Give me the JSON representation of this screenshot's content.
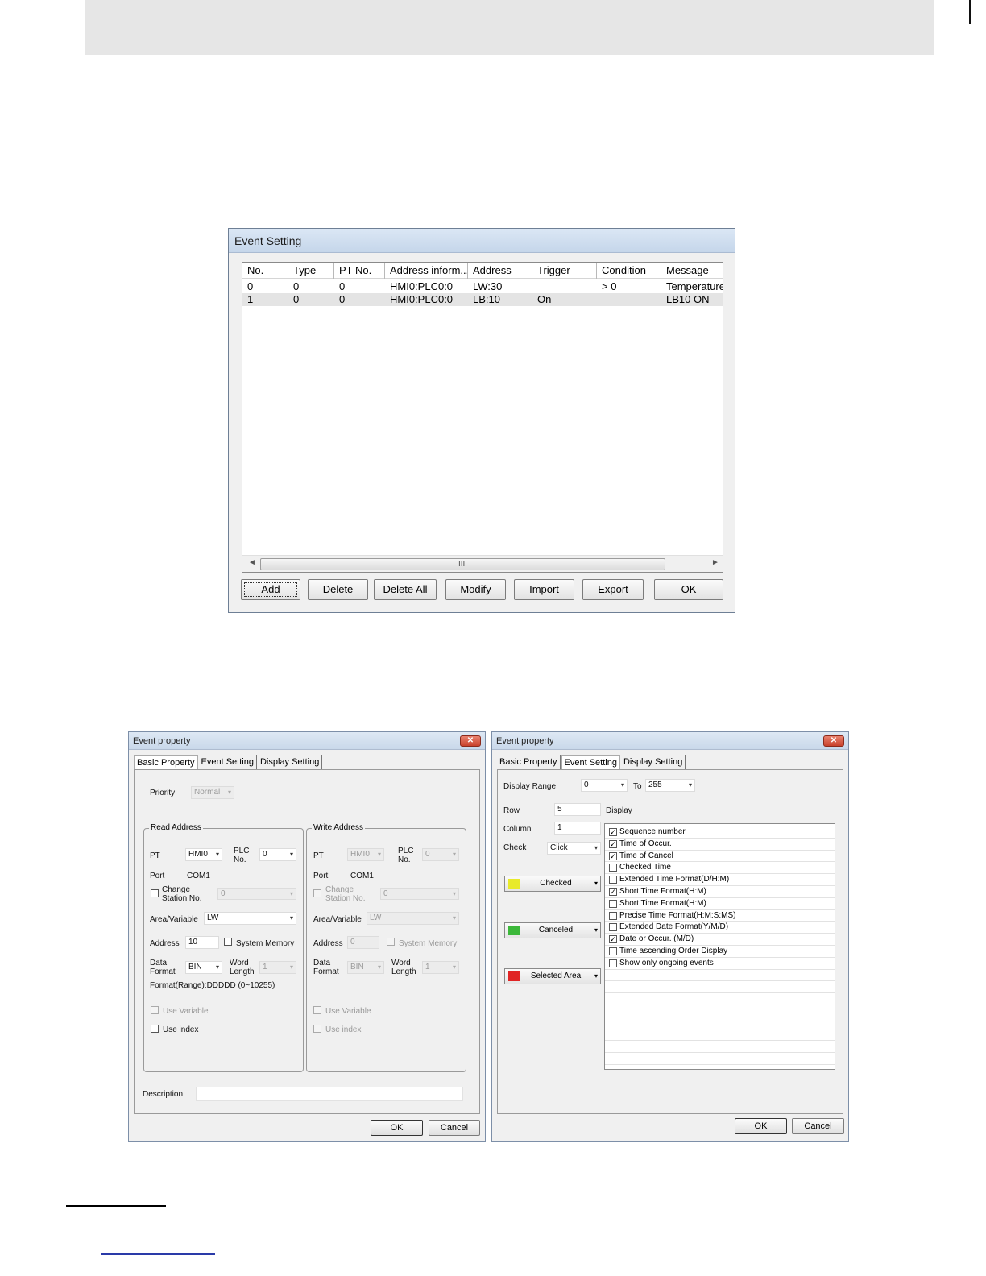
{
  "event_setting": {
    "title": "Event Setting",
    "columns": [
      "No.",
      "Type",
      "PT No.",
      "Address inform...",
      "Address",
      "Trigger",
      "Condition",
      "Message"
    ],
    "rows": [
      [
        "0",
        "0",
        "0",
        "HMI0:PLC0:0",
        "LW:30",
        "",
        "> 0",
        "Temperature"
      ],
      [
        "1",
        "0",
        "0",
        "HMI0:PLC0:0",
        "LB:10",
        "On",
        "",
        "LB10 ON"
      ]
    ],
    "scroll": {
      "left": "◄",
      "right": "►",
      "grip": "III"
    },
    "buttons": {
      "add": "Add",
      "delete": "Delete",
      "delete_all": "Delete All",
      "modify": "Modify",
      "import": "Import",
      "export": "Export",
      "ok": "OK"
    }
  },
  "left_dialog": {
    "title": "Event property",
    "close": "✕",
    "tabs": [
      "Basic Property",
      "Event Setting",
      "Display Setting"
    ],
    "priority_label": "Priority",
    "priority_value": "Normal",
    "read": {
      "group": "Read Address",
      "pt_label": "PT",
      "pt_value": "HMI0",
      "plc_label_1": "PLC",
      "plc_label_2": "No.",
      "plc_value": "0",
      "port_label": "Port",
      "port_value": "COM1",
      "change_1": "Change",
      "change_2": "Station No.",
      "station_value": "0",
      "area_label": "Area/Variable",
      "area_value": "LW",
      "address_label": "Address",
      "address_value": "10",
      "sysmem_label": "System Memory",
      "data_1": "Data",
      "data_2": "Format",
      "data_value": "BIN",
      "word_1": "Word",
      "word_2": "Length",
      "word_value": "1",
      "format_range": "Format(Range):DDDDD (0~10255)",
      "use_variable": "Use Variable",
      "use_index": "Use index"
    },
    "write": {
      "group": "Write Address",
      "pt_label": "PT",
      "pt_value": "HMI0",
      "plc_label_1": "PLC",
      "plc_label_2": "No.",
      "plc_value": "0",
      "port_label": "Port",
      "port_value": "COM1",
      "change_1": "Change",
      "change_2": "Station No.",
      "station_value": "0",
      "area_label": "Area/Variable",
      "area_value": "LW",
      "address_label": "Address",
      "address_value": "0",
      "sysmem_label": "System Memory",
      "data_1": "Data",
      "data_2": "Format",
      "data_value": "BIN",
      "word_1": "Word",
      "word_2": "Length",
      "word_value": "1",
      "use_variable": "Use Variable",
      "use_index": "Use index"
    },
    "description_label": "Description",
    "description_value": "",
    "ok": "OK",
    "cancel": "Cancel"
  },
  "right_dialog": {
    "title": "Event property",
    "close": "✕",
    "tabs": [
      "Basic Property",
      "Event Setting",
      "Display Setting"
    ],
    "display_range_label": "Display Range",
    "range_from": "0",
    "to_label": "To",
    "range_to": "255",
    "row_label": "Row",
    "row_value": "5",
    "display_label": "Display",
    "column_label": "Column",
    "column_value": "1",
    "check_label": "Check",
    "check_value": "Click",
    "checked_btn": "Checked",
    "canceled_btn": "Canceled",
    "selected_btn": "Selected Area",
    "colors": {
      "checked": "#e8ea2a",
      "canceled": "#3cb83a",
      "selected": "#e02424"
    },
    "display_items": [
      {
        "label": "Sequence number",
        "checked": true
      },
      {
        "label": "Time of Occur.",
        "checked": true
      },
      {
        "label": "Time of Cancel",
        "checked": true
      },
      {
        "label": "Checked Time",
        "checked": false
      },
      {
        "label": "Extended Time Format(D/H:M)",
        "checked": false
      },
      {
        "label": "Short Time Format(H:M)",
        "checked": true
      },
      {
        "label": "Short Time Format(H:M)",
        "checked": false
      },
      {
        "label": "Precise Time Format(H:M:S:MS)",
        "checked": false
      },
      {
        "label": "Extended Date Format(Y/M/D)",
        "checked": false
      },
      {
        "label": "Date or Occur.  (M/D)",
        "checked": true
      },
      {
        "label": "Time ascending Order Display",
        "checked": false
      },
      {
        "label": "Show only ongoing events",
        "checked": false
      }
    ],
    "ok": "OK",
    "cancel": "Cancel"
  }
}
